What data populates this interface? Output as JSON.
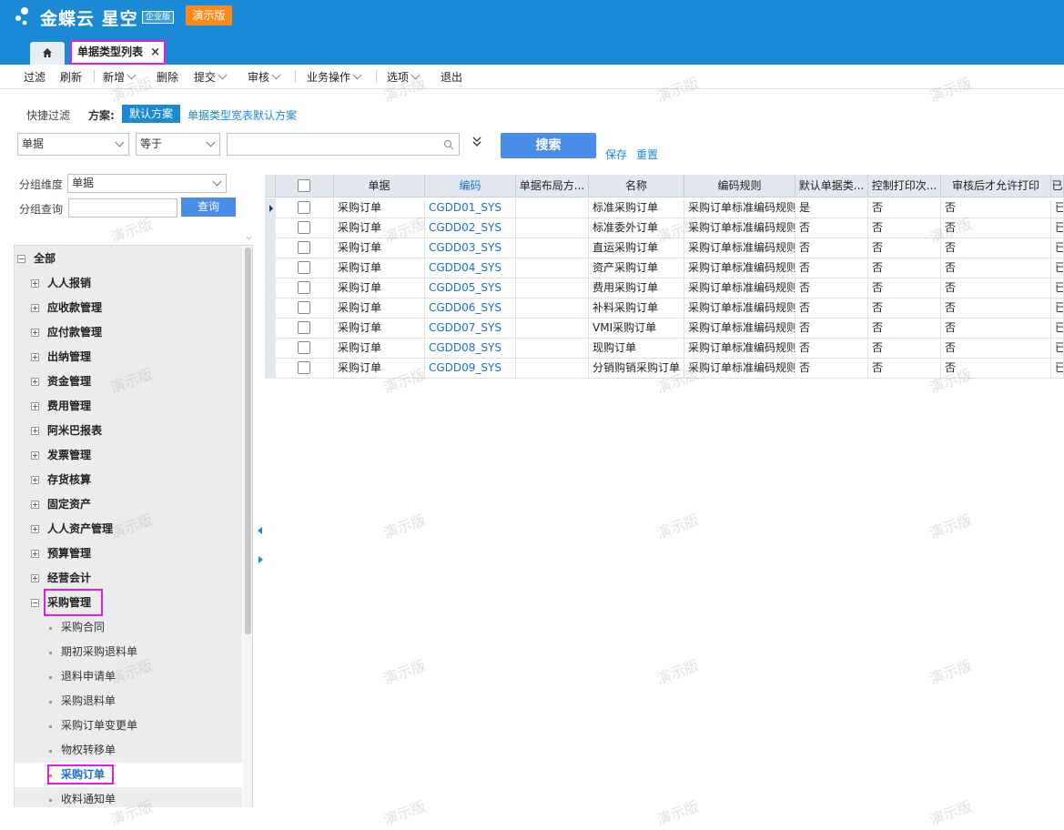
{
  "app": {
    "logo_text": "金蝶云 星空",
    "logo_sub": "企业版",
    "demo_badge": "演示版",
    "colors": {
      "header": "#1a8ad6",
      "badge": "#ff8a1c",
      "highlight": "#e020e0",
      "link": "#1a8ad6"
    }
  },
  "tabs": {
    "home_icon": "home-icon",
    "active_tab": "单据类型列表",
    "close_glyph": "×"
  },
  "toolbar": {
    "filter": "过滤",
    "refresh": "刷新",
    "new": "新增",
    "delete": "删除",
    "submit": "提交",
    "audit": "审核",
    "business": "业务操作",
    "options": "选项",
    "exit": "退出"
  },
  "quickfilter": {
    "label": "快捷过滤",
    "scheme_label": "方案:",
    "scheme_default": "默认方案",
    "scheme_other": "单据类型宽表默认方案",
    "field_value": "单据",
    "operator_value": "等于",
    "search_value": "",
    "search_button": "搜索",
    "save_link": "保存",
    "reset_link": "重置"
  },
  "group": {
    "dimension_label": "分组维度",
    "dimension_value": "单据",
    "query_label": "分组查询",
    "query_value": "",
    "query_button": "查询"
  },
  "tree": {
    "root": "全部",
    "nodes": [
      "人人报销",
      "应收款管理",
      "应付款管理",
      "出纳管理",
      "资金管理",
      "费用管理",
      "阿米巴报表",
      "发票管理",
      "存货核算",
      "固定资产",
      "人人资产管理",
      "预算管理",
      "经营会计",
      "采购管理"
    ],
    "leaves": [
      "采购合同",
      "期初采购退料单",
      "退料申请单",
      "采购退料单",
      "采购订单变更单",
      "物权转移单",
      "采购订单",
      "收料通知单"
    ]
  },
  "grid": {
    "headers": [
      "单据",
      "编码",
      "单据布局方...",
      "名称",
      "编码规则",
      "默认单据类...",
      "控制打印次...",
      "审核后才允许打印",
      "已"
    ],
    "rows": [
      [
        "采购订单",
        "CGDD01_SYS",
        "",
        "标准采购订单",
        "采购订单标准编码规则",
        "是",
        "否",
        "否",
        "已"
      ],
      [
        "采购订单",
        "CGDD02_SYS",
        "",
        "标准委外订单",
        "采购订单标准编码规则",
        "否",
        "否",
        "否",
        "已"
      ],
      [
        "采购订单",
        "CGDD03_SYS",
        "",
        "直运采购订单",
        "采购订单标准编码规则",
        "否",
        "否",
        "否",
        "已"
      ],
      [
        "采购订单",
        "CGDD04_SYS",
        "",
        "资产采购订单",
        "采购订单标准编码规则",
        "否",
        "否",
        "否",
        "已"
      ],
      [
        "采购订单",
        "CGDD05_SYS",
        "",
        "费用采购订单",
        "采购订单标准编码规则",
        "否",
        "否",
        "否",
        "已"
      ],
      [
        "采购订单",
        "CGDD06_SYS",
        "",
        "补料采购订单",
        "采购订单标准编码规则",
        "否",
        "否",
        "否",
        "已"
      ],
      [
        "采购订单",
        "CGDD07_SYS",
        "",
        "VMI采购订单",
        "采购订单标准编码规则",
        "否",
        "否",
        "否",
        "已"
      ],
      [
        "采购订单",
        "CGDD08_SYS",
        "",
        "现购订单",
        "采购订单标准编码规则",
        "否",
        "否",
        "否",
        "已"
      ],
      [
        "采购订单",
        "CGDD09_SYS",
        "",
        "分销购销采购订单",
        "采购订单标准编码规则",
        "否",
        "否",
        "否",
        "已"
      ]
    ]
  },
  "watermark": "演示版"
}
